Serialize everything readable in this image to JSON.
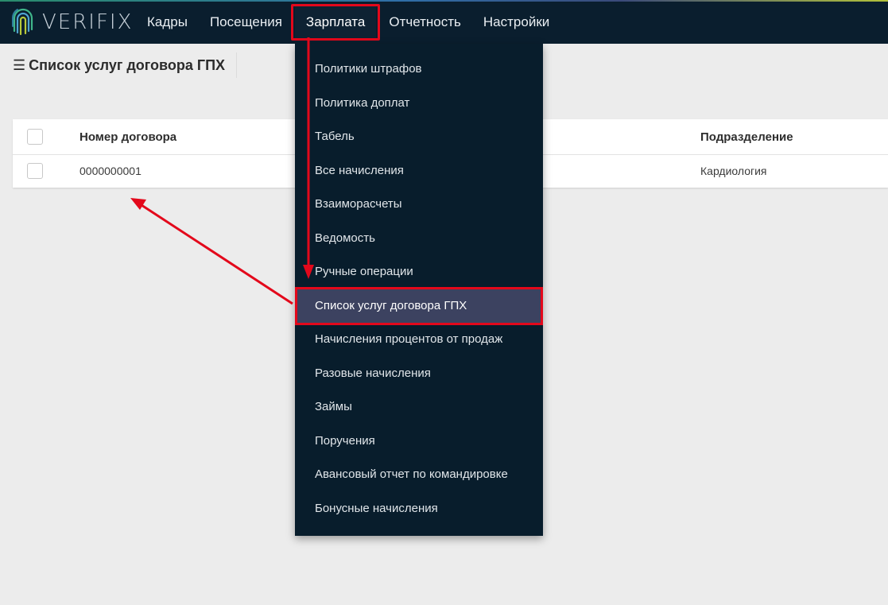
{
  "app": {
    "logo_text": "VERIFIX",
    "logo_icon": "fingerprint-logo"
  },
  "nav": {
    "items": [
      {
        "label": "Кадры"
      },
      {
        "label": "Посещения"
      },
      {
        "label": "Зарплата"
      },
      {
        "label": "Отчетность"
      },
      {
        "label": "Настройки"
      }
    ],
    "active": "Зарплата"
  },
  "page": {
    "menu_icon": "hamburger-icon",
    "title": "Список услуг договора ГПХ"
  },
  "table": {
    "columns": [
      "Номер договора",
      "Подразделение"
    ],
    "rows": [
      {
        "number": "0000000001",
        "department": "Кардиология"
      }
    ]
  },
  "dropdown": {
    "items": [
      {
        "label": "Политики штрафов"
      },
      {
        "label": "Политика доплат"
      },
      {
        "label": "Табель"
      },
      {
        "label": "Все начисления"
      },
      {
        "label": "Взаиморасчеты"
      },
      {
        "label": "Ведомость"
      },
      {
        "label": "Ручные операции"
      },
      {
        "label": "Список услуг договора ГПХ"
      },
      {
        "label": "Начисления процентов от продаж"
      },
      {
        "label": "Разовые начисления"
      },
      {
        "label": "Займы"
      },
      {
        "label": "Поручения"
      },
      {
        "label": "Авансовый отчет по командировке"
      },
      {
        "label": "Бонусные начисления"
      }
    ],
    "active": "Список услуг договора ГПХ"
  },
  "colors": {
    "topbar": "#0a1e2e",
    "dropdown": "#081d2c",
    "active_menu_item": "#3c4260",
    "annotation": "#e3081b",
    "background": "#ececec"
  }
}
